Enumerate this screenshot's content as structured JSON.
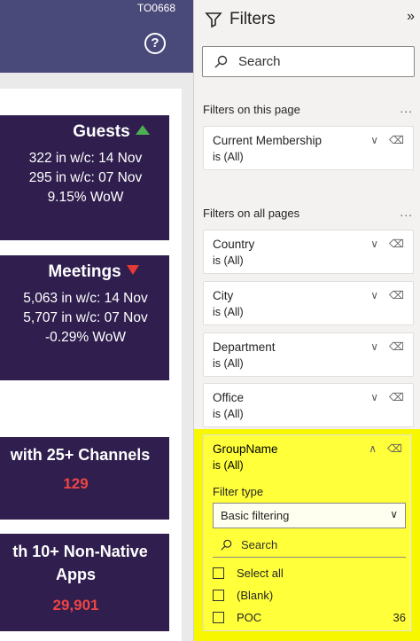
{
  "report": {
    "id_label": "TO0668",
    "help_glyph": "?",
    "cards": {
      "guests": {
        "title": "Guests",
        "trend": "up",
        "line1": "322 in w/c: 14 Nov",
        "line2": "295 in w/c: 07 Nov",
        "line3": "9.15% WoW"
      },
      "meetings": {
        "title": "Meetings",
        "trend": "down",
        "line1": "5,063 in w/c: 14 Nov",
        "line2": "5,707 in w/c: 07 Nov",
        "line3": "-0.29% WoW"
      },
      "channels": {
        "title": "with 25+ Channels",
        "value": "129"
      },
      "apps": {
        "title_line1": "th 10+ Non-Native",
        "title_line2": "Apps",
        "value": "29,901"
      }
    }
  },
  "filters": {
    "title": "Filters",
    "search_placeholder": "Search",
    "section_page": "Filters on this page",
    "section_all": "Filters on all pages",
    "more_glyph": "...",
    "page_filters": [
      {
        "name": "Current Membership",
        "value": "is (All)"
      }
    ],
    "all_filters": [
      {
        "name": "Country",
        "value": "is (All)"
      },
      {
        "name": "City",
        "value": "is (All)"
      },
      {
        "name": "Department",
        "value": "is (All)"
      },
      {
        "name": "Office",
        "value": "is (All)"
      }
    ],
    "groupname": {
      "name": "GroupName",
      "value": "is (All)",
      "filter_type_label": "Filter type",
      "filter_type_value": "Basic filtering",
      "search_placeholder": "Search",
      "options": [
        {
          "label": "Select all",
          "count": ""
        },
        {
          "label": "(Blank)",
          "count": ""
        },
        {
          "label": "POC",
          "count": "36"
        }
      ]
    },
    "highlight_color": "#ffff00"
  }
}
